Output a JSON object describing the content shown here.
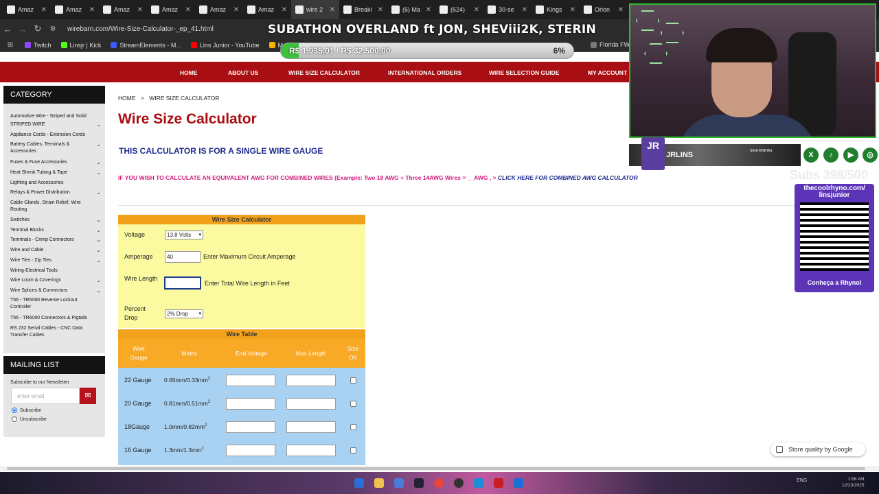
{
  "browser": {
    "tabs": [
      {
        "label": "Amaz",
        "active": false
      },
      {
        "label": "Amaz",
        "active": false
      },
      {
        "label": "Amaz",
        "active": false
      },
      {
        "label": "Amaz",
        "active": false
      },
      {
        "label": "Amaz",
        "active": false
      },
      {
        "label": "Amaz",
        "active": false
      },
      {
        "label": "wire 2",
        "active": true
      },
      {
        "label": "Breaki",
        "active": false
      },
      {
        "label": "(6) Ma",
        "active": false
      },
      {
        "label": "(624)",
        "active": false
      },
      {
        "label": "30-se",
        "active": false
      },
      {
        "label": "Kings",
        "active": false
      },
      {
        "label": "Orion",
        "active": false
      }
    ],
    "url": "wirebarn.com/Wire-Size-Calculator-_ep_41.html",
    "bookmarks": [
      {
        "label": "Twitch",
        "color": "#9146ff"
      },
      {
        "label": "Linsjr | Kick",
        "color": "#53fc18"
      },
      {
        "label": "StreamElements - M...",
        "color": "#3d5afe"
      },
      {
        "label": "Lins Junior - YouTube",
        "color": "#ff0000"
      },
      {
        "label": "Meu Drive",
        "color": "#f4b400"
      }
    ],
    "bookmark_right": "Florida FWC"
  },
  "stream": {
    "title": "SUBATHON OVERLAND ft JON, SHEViii2K, STERIN",
    "goal_text": "R$ 1.935,01 / R$ 32.500,00",
    "goal_percent_label": "6%",
    "goal_fraction": 0.06,
    "brand_name": "JRLINS",
    "brand_tag": "SIGA MINHAS",
    "brand_logo": "JR",
    "subs_text": "Subs 398/500",
    "qr_url": "thecoolrhyno.com/ linsjunior",
    "qr_cta": "Conheça a Rhynol",
    "socials": [
      "X",
      "♪",
      "▶",
      "◎"
    ]
  },
  "site": {
    "nav": [
      "HOME",
      "ABOUT US",
      "WIRE SIZE CALCULATOR",
      "INTERNATIONAL ORDERS",
      "WIRE SELECTION GUIDE",
      "MY ACCOUNT"
    ],
    "category": {
      "title": "CATEGORY",
      "items": [
        {
          "label": "Automotive Wire - Striped and Solid",
          "chevron": false
        },
        {
          "label": "STRIPED WIRE",
          "chevron": true
        },
        {
          "label": "Appliance Cords - Extension Cords",
          "chevron": false
        },
        {
          "label": "Battery Cables, Terminals & Accessories",
          "chevron": true
        },
        {
          "label": "Fuses & Fuse Accessories",
          "chevron": true
        },
        {
          "label": "Heat Shrink Tubing & Tape",
          "chevron": true
        },
        {
          "label": "Lighting and Accessories",
          "chevron": false
        },
        {
          "label": "Relays & Power Distribution",
          "chevron": true
        },
        {
          "label": "Cable Glands, Strain Relief, Wire Routing",
          "chevron": false
        },
        {
          "label": "Switches",
          "chevron": true
        },
        {
          "label": "Terminal Blocks",
          "chevron": true
        },
        {
          "label": "Terminals - Crimp Connectors",
          "chevron": true
        },
        {
          "label": "Wire and Cable",
          "chevron": true
        },
        {
          "label": "Wire Ties - Zip Ties",
          "chevron": true
        },
        {
          "label": "Wiring-Electrical Tools",
          "chevron": false
        },
        {
          "label": "Wire Loom & Coverings",
          "chevron": true
        },
        {
          "label": "Wire Splices & Connectors",
          "chevron": true
        },
        {
          "label": "T56 - TR6060 Reverse Lockout Controller",
          "chevron": false
        },
        {
          "label": "T56 - TR6060 Connectors & Pigtails",
          "chevron": false
        },
        {
          "label": "RS 232 Serial Cables - CNC Data Transfer Cables",
          "chevron": false
        }
      ]
    },
    "mailing": {
      "title": "MAILING LIST",
      "subtitle": "Subscribe to our Newsletter",
      "email_placeholder": "enter email",
      "subscribe": "Subscribe",
      "unsubscribe": "Unsubscribe"
    },
    "breadcrumb": {
      "home": "HOME",
      "sep": ">",
      "current": "WIRE SIZE CALCULATOR"
    },
    "title": "Wire Size Calculator",
    "single_gauge": "THIS CALCULATOR IS FOR A SINGLE WIRE GAUGE",
    "combined_note": "IF YOU WISH TO CALCULATE AN EQUIVALENT AWG FOR COMBINED WIRES (Example: Two 18 AWG + Three 14AWG Wires = __AWG ,",
    "combined_arrow": ">",
    "combined_link": "CLICK HERE FOR COMBINED AWG CALCULATOR",
    "calc": {
      "header": "Wire Size Calculator",
      "voltage_label": "Voltage",
      "voltage_value": "13.8 Volts",
      "amperage_label": "Amperage",
      "amperage_value": "40",
      "amperage_hint": "Enter Maximum Circuit Amperage",
      "wire_length_label": "Wire Length",
      "wire_length_value": "",
      "wire_length_hint": "Enter Total Wire Length in Feet",
      "drop_label": "Percent Drop",
      "drop_value": "2% Drop"
    },
    "wire_table": {
      "header": "Wire Table",
      "columns": [
        "Wire Gauge",
        "Metric",
        "End Voltage",
        "Max Length",
        "Size OK"
      ],
      "rows": [
        {
          "gauge": "22 Gauge",
          "metric": "0.65mm/0.33mm",
          "sup": "2"
        },
        {
          "gauge": "20 Gauge",
          "metric": "0.81mm/0.51mm",
          "sup": "2"
        },
        {
          "gauge": "18Gauge",
          "metric": "1.0mm/0.82mm",
          "sup": "2"
        },
        {
          "gauge": "16 Gauge",
          "metric": "1.3mm/1.3mm",
          "sup": "2"
        }
      ]
    },
    "store_quality": "Store quality by Google"
  },
  "taskbar": {
    "tray": "ENG",
    "clock_time": "1:58 AM",
    "clock_date": "12/23/2025"
  }
}
